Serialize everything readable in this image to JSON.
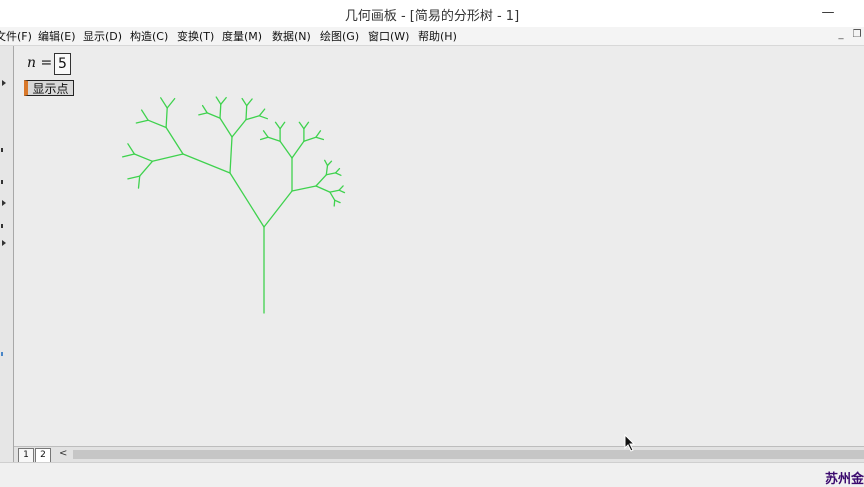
{
  "window": {
    "title": "几何画板 - [简易的分形树 - 1]",
    "minimize_glyph": "—"
  },
  "menu": {
    "items": [
      "文件(F)",
      "编辑(E)",
      "显示(D)",
      "构造(C)",
      "变换(T)",
      "度量(M)",
      "数据(N)",
      "绘图(G)",
      "窗口(W)",
      "帮助(H)"
    ],
    "mdi_minimize_glyph": "_",
    "mdi_restore_glyph": "❐"
  },
  "sketch": {
    "param_name": "n",
    "param_equals": "=",
    "param_value": "5",
    "show_points_label": "显示点",
    "tree_color": "#3fd24e",
    "tree_depth": 5
  },
  "pages": {
    "tabs": [
      "1",
      "2"
    ],
    "scroll_left_glyph": "<"
  },
  "status": {
    "watermark": "苏州金"
  },
  "colors": {
    "accent": "#d9782a",
    "watermark": "#3b0a6e"
  }
}
